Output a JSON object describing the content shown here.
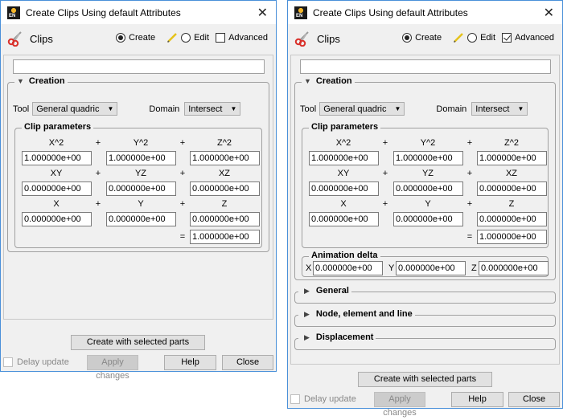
{
  "windows": [
    {
      "title": "Create Clips Using default Attributes",
      "header": {
        "label": "Clips",
        "create_label": "Create",
        "create_selected": true,
        "edit_label": "Edit",
        "edit_selected": false,
        "advanced_label": "Advanced",
        "advanced_checked": false
      },
      "name_input": "",
      "creation": {
        "title": "Creation",
        "tool_label": "Tool",
        "tool_value": "General quadric",
        "domain_label": "Domain",
        "domain_value": "Intersect",
        "clip_params": {
          "title": "Clip parameters",
          "rows": [
            {
              "labels": [
                "X^2",
                "Y^2",
                "Z^2"
              ],
              "ops": [
                "+",
                "+"
              ],
              "values": [
                "1.000000e+00",
                "1.000000e+00",
                "1.000000e+00"
              ]
            },
            {
              "labels": [
                "XY",
                "YZ",
                "XZ"
              ],
              "ops": [
                "+",
                "+"
              ],
              "values": [
                "0.000000e+00",
                "0.000000e+00",
                "0.000000e+00"
              ]
            },
            {
              "labels": [
                "X",
                "Y",
                "Z"
              ],
              "ops": [
                "+",
                "+"
              ],
              "values": [
                "0.000000e+00",
                "0.000000e+00",
                "0.000000e+00"
              ]
            }
          ],
          "equals": "=",
          "constant": "1.000000e+00"
        }
      },
      "buttons": {
        "create_with_parts": "Create with selected parts",
        "delay_update": "Delay update",
        "apply_changes": "Apply changes",
        "help": "Help",
        "close": "Close"
      }
    },
    {
      "title": "Create Clips Using default Attributes",
      "header": {
        "label": "Clips",
        "create_label": "Create",
        "create_selected": true,
        "edit_label": "Edit",
        "edit_selected": false,
        "advanced_label": "Advanced",
        "advanced_checked": true
      },
      "name_input": "",
      "creation": {
        "title": "Creation",
        "tool_label": "Tool",
        "tool_value": "General quadric",
        "domain_label": "Domain",
        "domain_value": "Intersect",
        "clip_params": {
          "title": "Clip parameters",
          "rows": [
            {
              "labels": [
                "X^2",
                "Y^2",
                "Z^2"
              ],
              "ops": [
                "+",
                "+"
              ],
              "values": [
                "1.000000e+00",
                "1.000000e+00",
                "1.000000e+00"
              ]
            },
            {
              "labels": [
                "XY",
                "YZ",
                "XZ"
              ],
              "ops": [
                "+",
                "+"
              ],
              "values": [
                "0.000000e+00",
                "0.000000e+00",
                "0.000000e+00"
              ]
            },
            {
              "labels": [
                "X",
                "Y",
                "Z"
              ],
              "ops": [
                "+",
                "+"
              ],
              "values": [
                "0.000000e+00",
                "0.000000e+00",
                "0.000000e+00"
              ]
            }
          ],
          "equals": "=",
          "constant": "1.000000e+00"
        },
        "animation_delta": {
          "title": "Animation delta",
          "labels": [
            "X",
            "Y",
            "Z"
          ],
          "values": [
            "0.000000e+00",
            "0.000000e+00",
            "0.000000e+00"
          ]
        }
      },
      "sections": [
        "General",
        "Node, element and line",
        "Displacement"
      ],
      "buttons": {
        "create_with_parts": "Create with selected parts",
        "delay_update": "Delay update",
        "apply_changes": "Apply changes",
        "help": "Help",
        "close": "Close"
      }
    }
  ]
}
